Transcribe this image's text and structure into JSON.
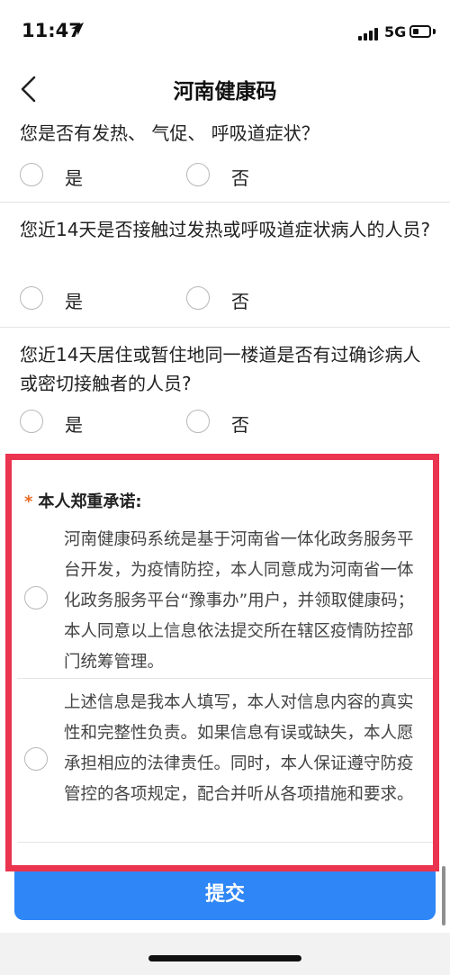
{
  "status_bar": {
    "time": "11:47",
    "network": "5G",
    "battery_level": 0.35
  },
  "nav": {
    "title": "河南健康码",
    "back_icon": "chevron-left-icon"
  },
  "questions": [
    {
      "text": "您是否有发热、 气促、 呼吸道症状？",
      "options": [
        "是",
        "否"
      ]
    },
    {
      "text": "您近14天是否接触过发热或呼吸道症状病人的人员?",
      "options": [
        "是",
        "否"
      ]
    },
    {
      "text": "您近14天居住或暂住地同一楼道是否有过确诊病人或密切接触者的人员?",
      "options": [
        "是",
        "否"
      ]
    }
  ],
  "promise": {
    "asterisk": "*",
    "title": "本人郑重承诺:",
    "highlight_color": "#ea3450",
    "items": [
      {
        "text": "河南健康码系统是基于河南省一体化政务服务平台开发，为疫情防控，本人同意成为河南省一体化政务服务平台“豫事办”用户，并领取健康码；本人同意以上信息依法提交所在辖区疫情防控部门统筹管理。"
      },
      {
        "text": "上述信息是我本人填写，本人对信息内容的真实性和完整性负责。如果信息有误或缺失，本人愿承担相应的法律责任。同时，本人保证遵守防疫管控的各项规定，配合并听从各项措施和要求。"
      }
    ]
  },
  "submit": {
    "label": "提交",
    "color": "#2f86f6"
  }
}
